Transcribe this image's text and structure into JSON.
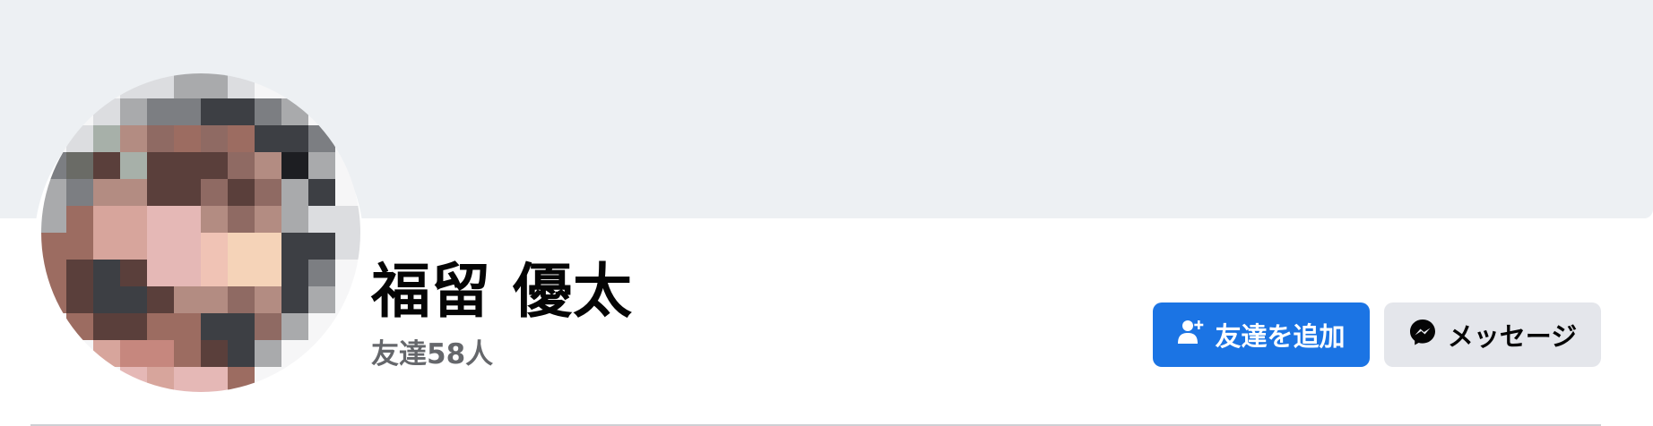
{
  "profile": {
    "name": "福留 優太",
    "friends_count": "友達58人"
  },
  "actions": {
    "add_friend_label": "友達を追加",
    "message_label": "メッセージ"
  },
  "icons": {
    "add_friend": "person-add-icon",
    "message": "messenger-icon"
  },
  "colors": {
    "primary_button": "#1b74e4",
    "secondary_button": "#e4e6eb",
    "cover_background": "#edf0f3",
    "secondary_text": "#65676b"
  }
}
